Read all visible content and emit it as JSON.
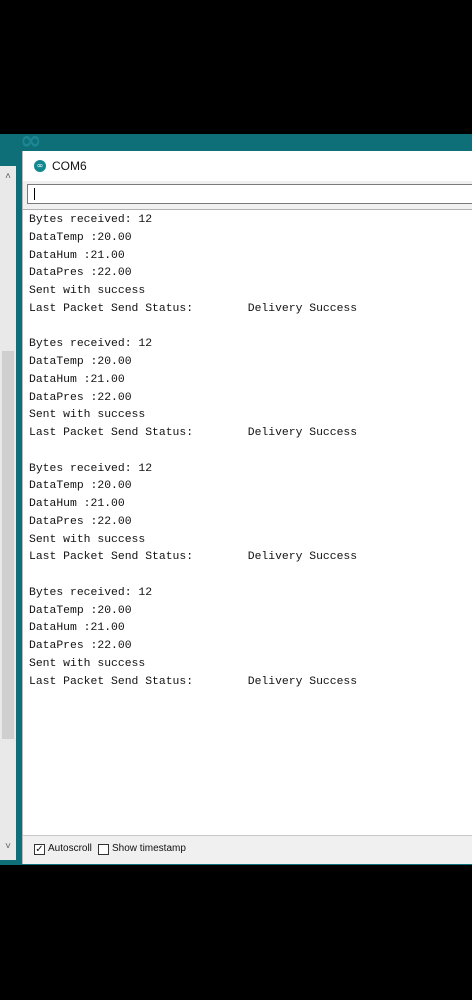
{
  "window": {
    "title": "COM6",
    "app_icon": "arduino-infinity-icon",
    "background_text": "∞"
  },
  "send": {
    "value": ""
  },
  "output": {
    "lines": [
      "Bytes received: 12",
      "DataTemp :20.00",
      "DataHum :21.00",
      "DataPres :22.00",
      "Sent with success",
      "Last Packet Send Status:        Delivery Success",
      "",
      "Bytes received: 12",
      "DataTemp :20.00",
      "DataHum :21.00",
      "DataPres :22.00",
      "Sent with success",
      "Last Packet Send Status:        Delivery Success",
      "",
      "Bytes received: 12",
      "DataTemp :20.00",
      "DataHum :21.00",
      "DataPres :22.00",
      "Sent with success",
      "Last Packet Send Status:        Delivery Success",
      "",
      "Bytes received: 12",
      "DataTemp :20.00",
      "DataHum :21.00",
      "DataPres :22.00",
      "Sent with success",
      "Last Packet Send Status:        Delivery Success"
    ]
  },
  "options": {
    "autoscroll_label": "Autoscroll",
    "autoscroll_checked": true,
    "timestamp_label": "Show timestamp",
    "timestamp_checked": false
  },
  "scrollbar": {
    "up_icon": "chevron-up-icon",
    "down_icon": "chevron-down-icon"
  },
  "colors": {
    "frame_teal": "#0e6f78",
    "text": "#111111"
  }
}
